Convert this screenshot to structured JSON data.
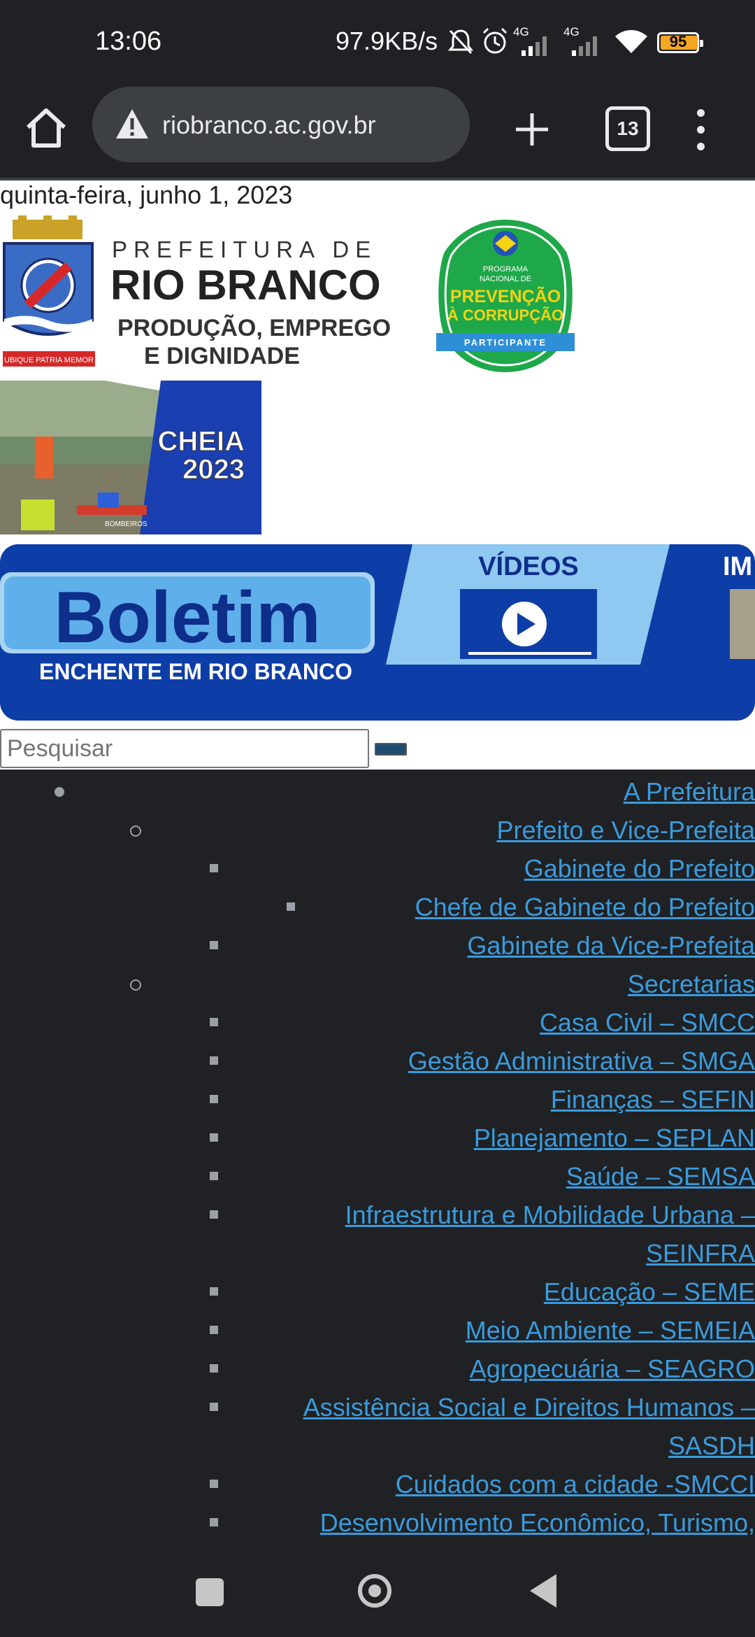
{
  "status_bar": {
    "time": "13:06",
    "net_speed": "97.9KB/s",
    "net_type_1": "4G",
    "net_type_2": "4G",
    "battery": "95",
    "icons": [
      "mute-bell-icon",
      "alarm-icon",
      "signal-icon",
      "signal-icon",
      "wifi-icon",
      "battery-icon"
    ]
  },
  "browser": {
    "url": "riobranco.ac.gov.br",
    "tab_count": "13",
    "icons": [
      "home-icon",
      "warning-icon",
      "plus-icon",
      "tabs-icon",
      "more-vert-icon"
    ]
  },
  "page": {
    "date": "quinta-feira, junho 1, 2023",
    "logo": {
      "line1": "PREFEITURA DE",
      "line2": "RIO BRANCO",
      "line3": "PRODUÇÃO, EMPREGO",
      "line4": "E DIGNIDADE",
      "motto": "UBIQUE PATRIA MEMOR"
    },
    "seal": {
      "line1": "PROGRAMA",
      "line2": "NACIONAL DE",
      "line3": "PREVENÇÃO",
      "line4": "À CORRUPÇÃO",
      "ribbon": "PARTICIPANTE"
    },
    "cheia_banner": {
      "line1": "CHEIA",
      "line2": "2023",
      "boat_text": "BOMBEIROS"
    },
    "boletim_banner": {
      "title": "Boletim",
      "subtitle": "ENCHENTE EM RIO BRANCO",
      "videos": "VÍDEOS",
      "next": "IM"
    },
    "search": {
      "placeholder": "Pesquisar"
    },
    "menu": [
      "A Prefeitura",
      "Prefeito e Vice-Prefeita",
      "Gabinete do Prefeito",
      "Chefe de Gabinete do Prefeito",
      "Gabinete da Vice-Prefeita",
      "Secretarias",
      "Casa Civil – SMCC",
      "Gestão Administrativa – SMGA",
      "Finanças – SEFIN",
      "Planejamento – SEPLAN",
      "Saúde – SEMSA",
      "Infraestrutura e Mobilidade Urbana –",
      "SEINFRA",
      "Educação – SEME",
      "Meio Ambiente – SEMEIA",
      "Agropecuária – SEAGRO",
      "Assistência Social e Direitos Humanos –",
      "SASDH",
      "Cuidados com a cidade -SMCCI",
      "Desenvolvimento Econômico, Turismo,"
    ]
  },
  "colors": {
    "link": "#3a9bdc",
    "dark_bg": "#202124",
    "banner_blue": "#0d3ea8",
    "logo_blue": "#2a3b8f"
  }
}
